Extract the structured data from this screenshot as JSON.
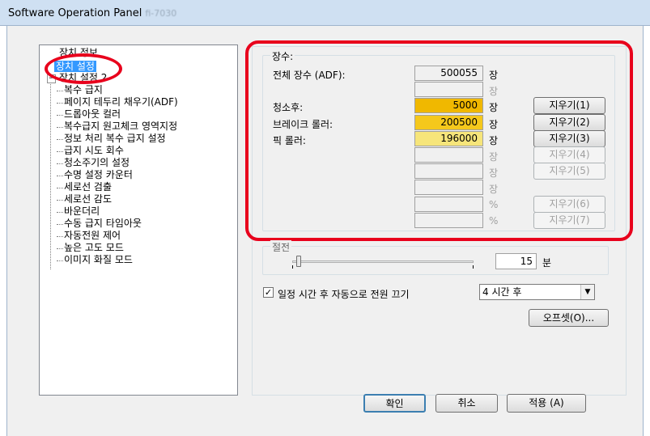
{
  "window": {
    "title": "Software Operation Panel",
    "subtitle": "fi-7030"
  },
  "tree": {
    "items": [
      {
        "label": "장치 정보"
      },
      {
        "label": "장치 설정"
      },
      {
        "label": "장치 설정 2"
      },
      {
        "label": "복수 급지"
      },
      {
        "label": "페이지 테두리 채우기(ADF)"
      },
      {
        "label": "드롭아웃 컬러"
      },
      {
        "label": "복수급지 원고체크 영역지정"
      },
      {
        "label": "정보 처리 복수 급지 설정"
      },
      {
        "label": "급지 시도 회수"
      },
      {
        "label": "청소주기의 설정"
      },
      {
        "label": "수명 설정 카운터"
      },
      {
        "label": "세로선 검출"
      },
      {
        "label": "세로선 감도"
      },
      {
        "label": "바운더리"
      },
      {
        "label": "수동 급지 타임아웃"
      },
      {
        "label": "자동전원 제어"
      },
      {
        "label": "높은 고도 모드"
      },
      {
        "label": "이미지 화질 모드"
      }
    ]
  },
  "counters": {
    "group_label": "장수:",
    "rows": [
      {
        "label": "전체 장수 (ADF):",
        "value": "500055",
        "unit": "장",
        "button": ""
      },
      {
        "label": "",
        "value": "",
        "unit": "장",
        "button": ""
      },
      {
        "label": "청소후:",
        "value": "5000",
        "unit": "장",
        "button": "지우기(1)"
      },
      {
        "label": "브레이크 롤러:",
        "value": "200500",
        "unit": "장",
        "button": "지우기(2)"
      },
      {
        "label": "픽 롤러:",
        "value": "196000",
        "unit": "장",
        "button": "지우기(3)"
      },
      {
        "label": "",
        "value": "",
        "unit": "장",
        "button": "지우기(4)"
      },
      {
        "label": "",
        "value": "",
        "unit": "장",
        "button": "지우기(5)"
      },
      {
        "label": "",
        "value": "",
        "unit": "장",
        "button": ""
      },
      {
        "label": "",
        "value": "",
        "unit": "%",
        "button": "지우기(6)"
      },
      {
        "label": "",
        "value": "",
        "unit": "%",
        "button": "지우기(7)"
      }
    ]
  },
  "power": {
    "group_label": "절전",
    "minutes_value": "15",
    "minutes_unit": "분",
    "auto_off_label": "일정 시간 후 자동으로 전원 끄기",
    "auto_off_checked": "✓",
    "auto_off_option": "4 시간 후",
    "offset_button": "오프셋(O)..."
  },
  "footer": {
    "ok": "확인",
    "cancel": "취소",
    "apply": "적용 (A)"
  },
  "colors": {
    "annotation": "#e8001c",
    "selection": "#3399ff",
    "counter_highlight": "#f0b800"
  }
}
